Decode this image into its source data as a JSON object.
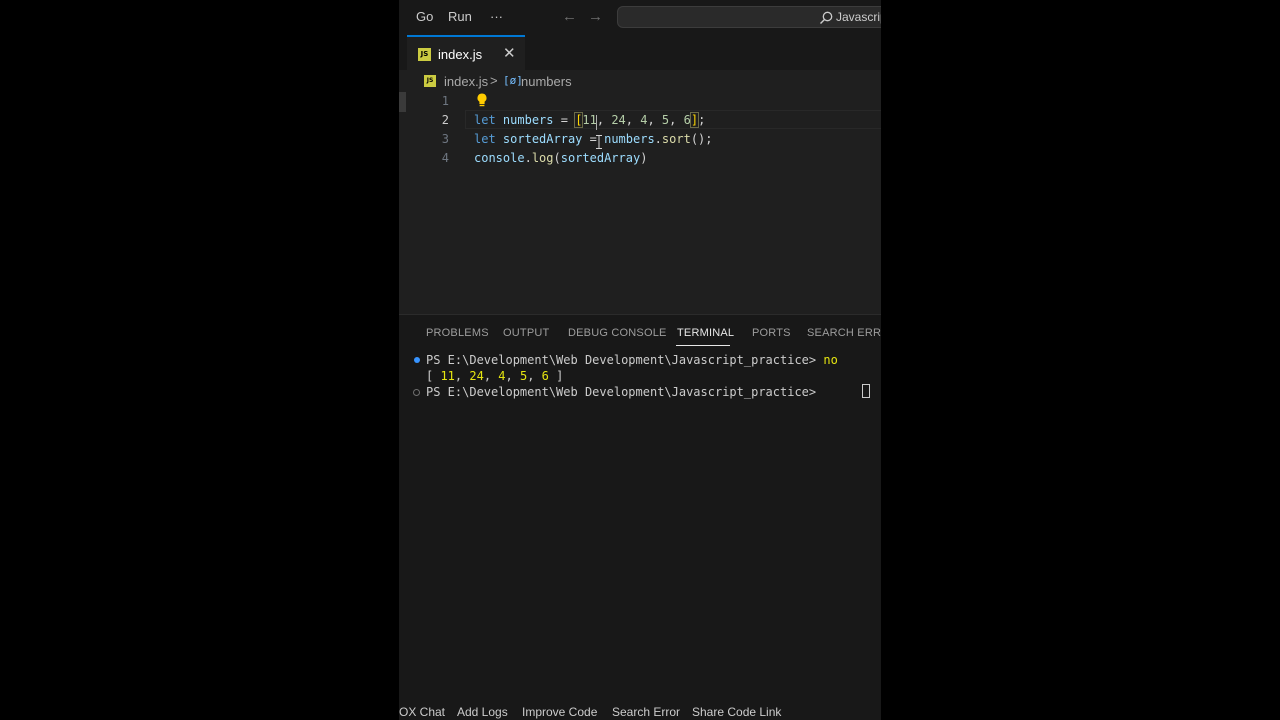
{
  "titlebar": {
    "menu": [
      "Go",
      "Run",
      "···"
    ],
    "back_arrow": "←",
    "forward_arrow": "→",
    "search_text": "Javascrip"
  },
  "tabs": [
    {
      "label": "index.js",
      "icon": "js-file-icon",
      "icon_text": "JS",
      "close": "✕"
    }
  ],
  "breadcrumb": {
    "file": "index.js",
    "separator": ">",
    "symbol_icon": "[ø]",
    "symbol": "numbers"
  },
  "editor": {
    "line_numbers": [
      "1",
      "2",
      "3",
      "4"
    ],
    "active_line": "2",
    "lines": [
      "",
      "let numbers = [11, 24, 4, 5, 6];",
      "let sortedArray = numbers.sort();",
      "console.log(sortedArray)"
    ],
    "tokens": {
      "l2": {
        "kw": "let",
        "var": "numbers",
        "eq": " = ",
        "open": "[",
        "n1": "11",
        "c1": ", ",
        "n2": "24",
        "c2": ", ",
        "n3": "4",
        "c3": ", ",
        "n4": "5",
        "c4": ", ",
        "n5": "6",
        "close": "]",
        "end": ";"
      },
      "l3": {
        "kw": "let",
        "var": "sortedArray",
        "eq": " = ",
        "obj": "numbers",
        "dot": ".",
        "fn": "sort",
        "rest": "();"
      },
      "l4": {
        "obj": "console",
        "dot": ".",
        "fn": "log",
        "open": "(",
        "arg": "sortedArray",
        "close": ")"
      }
    }
  },
  "panel": {
    "tabs": [
      "PROBLEMS",
      "OUTPUT",
      "DEBUG CONSOLE",
      "TERMINAL",
      "PORTS",
      "SEARCH ERROR"
    ],
    "active_tab": "TERMINAL",
    "terminal": {
      "prompt1": "PS E:\\Development\\Web Development\\Javascript_practice> ",
      "cmd1": "no",
      "output_open": "[ ",
      "out_values": [
        "11",
        "24",
        "4",
        "5",
        "6"
      ],
      "output_close": " ]",
      "prompt2": "PS E:\\Development\\Web Development\\Javascript_practice> "
    }
  },
  "statusbar": [
    "OX Chat",
    "Add Logs",
    "Improve Code",
    "Search Error",
    "Share Code Link"
  ],
  "colors": {
    "accent": "#0078d4",
    "js_yellow": "#cbcb41",
    "keyword": "#569cd6",
    "variable": "#9cdcfe",
    "number": "#b5cea8",
    "function": "#dcdcaa"
  }
}
